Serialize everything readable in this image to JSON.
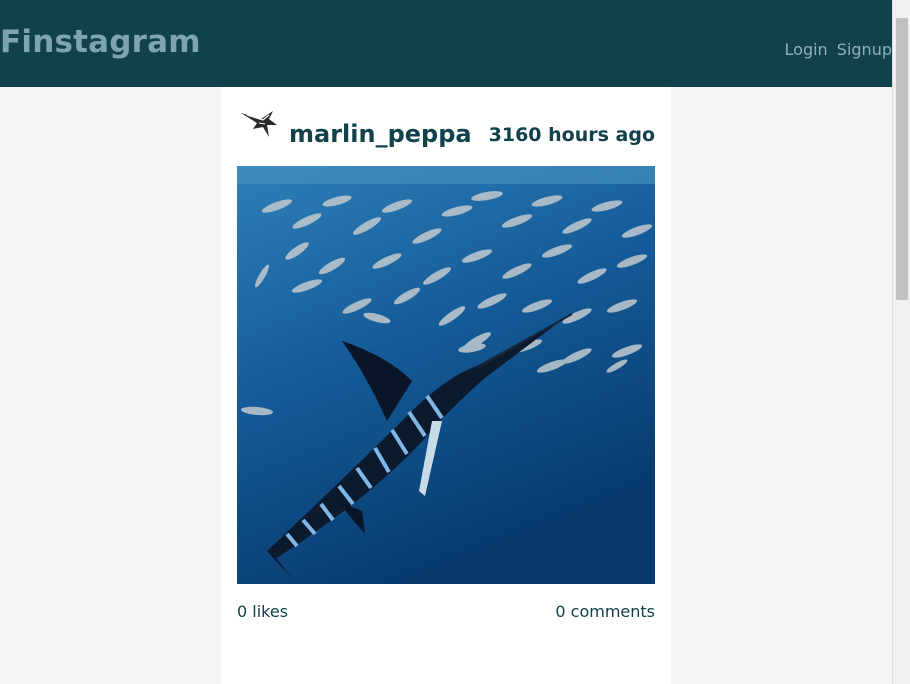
{
  "header": {
    "brand": "Finstagram",
    "login_label": "Login",
    "signup_label": "Signup"
  },
  "post": {
    "username": "marlin_peppa",
    "time_ago": "3160 hours ago",
    "avatar_icon": "marlin-avatar-icon",
    "image_subject": "striped-marlin-hunting-sardines",
    "likes": "0 likes",
    "comments": "0 comments"
  },
  "colors": {
    "header_bg": "#11414b",
    "brand": "#7ea4ae",
    "text_dark": "#11414b",
    "page_bg": "#f4f4f4"
  }
}
